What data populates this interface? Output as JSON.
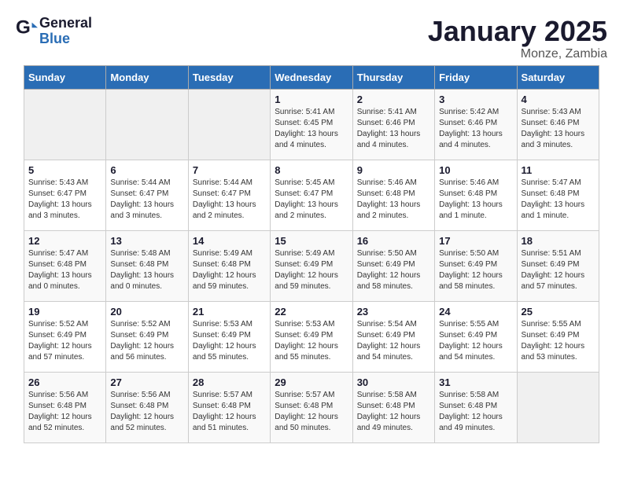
{
  "header": {
    "logo_line1": "General",
    "logo_line2": "Blue",
    "title": "January 2025",
    "subtitle": "Monze, Zambia"
  },
  "days_of_week": [
    "Sunday",
    "Monday",
    "Tuesday",
    "Wednesday",
    "Thursday",
    "Friday",
    "Saturday"
  ],
  "weeks": [
    [
      {
        "day": "",
        "empty": true
      },
      {
        "day": "",
        "empty": true
      },
      {
        "day": "",
        "empty": true
      },
      {
        "day": "1",
        "sunrise": "5:41 AM",
        "sunset": "6:45 PM",
        "daylight": "13 hours and 4 minutes."
      },
      {
        "day": "2",
        "sunrise": "5:41 AM",
        "sunset": "6:46 PM",
        "daylight": "13 hours and 4 minutes."
      },
      {
        "day": "3",
        "sunrise": "5:42 AM",
        "sunset": "6:46 PM",
        "daylight": "13 hours and 4 minutes."
      },
      {
        "day": "4",
        "sunrise": "5:43 AM",
        "sunset": "6:46 PM",
        "daylight": "13 hours and 3 minutes."
      }
    ],
    [
      {
        "day": "5",
        "sunrise": "5:43 AM",
        "sunset": "6:47 PM",
        "daylight": "13 hours and 3 minutes."
      },
      {
        "day": "6",
        "sunrise": "5:44 AM",
        "sunset": "6:47 PM",
        "daylight": "13 hours and 3 minutes."
      },
      {
        "day": "7",
        "sunrise": "5:44 AM",
        "sunset": "6:47 PM",
        "daylight": "13 hours and 2 minutes."
      },
      {
        "day": "8",
        "sunrise": "5:45 AM",
        "sunset": "6:47 PM",
        "daylight": "13 hours and 2 minutes."
      },
      {
        "day": "9",
        "sunrise": "5:46 AM",
        "sunset": "6:48 PM",
        "daylight": "13 hours and 2 minutes."
      },
      {
        "day": "10",
        "sunrise": "5:46 AM",
        "sunset": "6:48 PM",
        "daylight": "13 hours and 1 minute."
      },
      {
        "day": "11",
        "sunrise": "5:47 AM",
        "sunset": "6:48 PM",
        "daylight": "13 hours and 1 minute."
      }
    ],
    [
      {
        "day": "12",
        "sunrise": "5:47 AM",
        "sunset": "6:48 PM",
        "daylight": "13 hours and 0 minutes."
      },
      {
        "day": "13",
        "sunrise": "5:48 AM",
        "sunset": "6:48 PM",
        "daylight": "13 hours and 0 minutes."
      },
      {
        "day": "14",
        "sunrise": "5:49 AM",
        "sunset": "6:48 PM",
        "daylight": "12 hours and 59 minutes."
      },
      {
        "day": "15",
        "sunrise": "5:49 AM",
        "sunset": "6:49 PM",
        "daylight": "12 hours and 59 minutes."
      },
      {
        "day": "16",
        "sunrise": "5:50 AM",
        "sunset": "6:49 PM",
        "daylight": "12 hours and 58 minutes."
      },
      {
        "day": "17",
        "sunrise": "5:50 AM",
        "sunset": "6:49 PM",
        "daylight": "12 hours and 58 minutes."
      },
      {
        "day": "18",
        "sunrise": "5:51 AM",
        "sunset": "6:49 PM",
        "daylight": "12 hours and 57 minutes."
      }
    ],
    [
      {
        "day": "19",
        "sunrise": "5:52 AM",
        "sunset": "6:49 PM",
        "daylight": "12 hours and 57 minutes."
      },
      {
        "day": "20",
        "sunrise": "5:52 AM",
        "sunset": "6:49 PM",
        "daylight": "12 hours and 56 minutes."
      },
      {
        "day": "21",
        "sunrise": "5:53 AM",
        "sunset": "6:49 PM",
        "daylight": "12 hours and 55 minutes."
      },
      {
        "day": "22",
        "sunrise": "5:53 AM",
        "sunset": "6:49 PM",
        "daylight": "12 hours and 55 minutes."
      },
      {
        "day": "23",
        "sunrise": "5:54 AM",
        "sunset": "6:49 PM",
        "daylight": "12 hours and 54 minutes."
      },
      {
        "day": "24",
        "sunrise": "5:55 AM",
        "sunset": "6:49 PM",
        "daylight": "12 hours and 54 minutes."
      },
      {
        "day": "25",
        "sunrise": "5:55 AM",
        "sunset": "6:49 PM",
        "daylight": "12 hours and 53 minutes."
      }
    ],
    [
      {
        "day": "26",
        "sunrise": "5:56 AM",
        "sunset": "6:48 PM",
        "daylight": "12 hours and 52 minutes."
      },
      {
        "day": "27",
        "sunrise": "5:56 AM",
        "sunset": "6:48 PM",
        "daylight": "12 hours and 52 minutes."
      },
      {
        "day": "28",
        "sunrise": "5:57 AM",
        "sunset": "6:48 PM",
        "daylight": "12 hours and 51 minutes."
      },
      {
        "day": "29",
        "sunrise": "5:57 AM",
        "sunset": "6:48 PM",
        "daylight": "12 hours and 50 minutes."
      },
      {
        "day": "30",
        "sunrise": "5:58 AM",
        "sunset": "6:48 PM",
        "daylight": "12 hours and 49 minutes."
      },
      {
        "day": "31",
        "sunrise": "5:58 AM",
        "sunset": "6:48 PM",
        "daylight": "12 hours and 49 minutes."
      },
      {
        "day": "",
        "empty": true
      }
    ]
  ],
  "labels": {
    "sunrise": "Sunrise:",
    "sunset": "Sunset:",
    "daylight": "Daylight:"
  }
}
